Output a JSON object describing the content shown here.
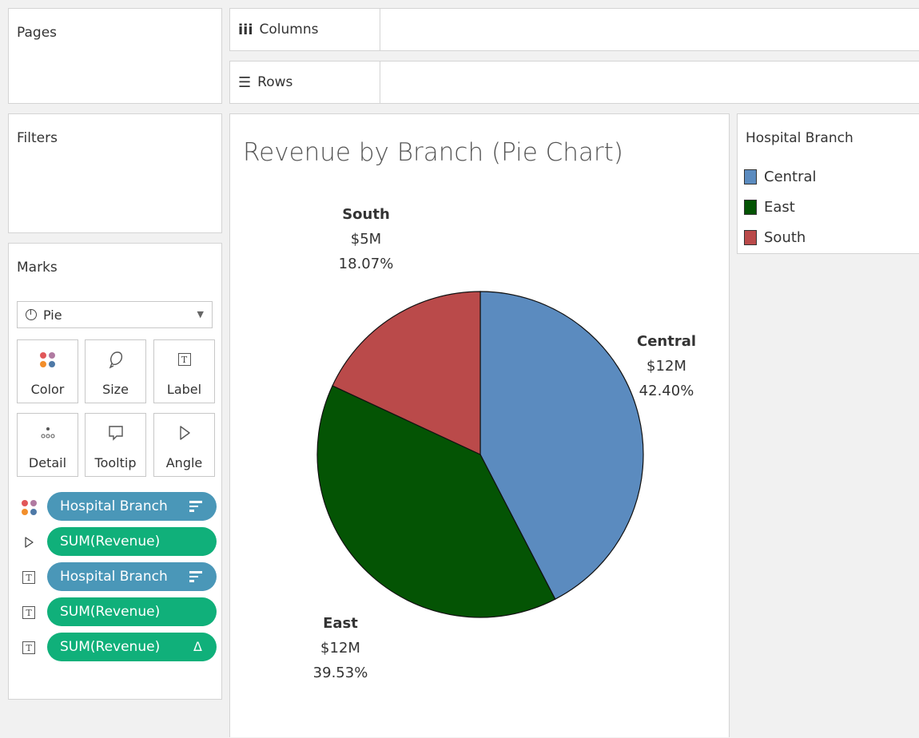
{
  "shelves": {
    "pages_label": "Pages",
    "filters_label": "Filters",
    "columns_label": "Columns",
    "rows_label": "Rows"
  },
  "marks": {
    "title": "Marks",
    "mark_type": "Pie",
    "buttons": [
      "Color",
      "Size",
      "Label",
      "Detail",
      "Tooltip",
      "Angle"
    ],
    "pills": [
      {
        "icon": "color-icon",
        "text": "Hospital Branch",
        "kind": "dimension",
        "suffix": "sort"
      },
      {
        "icon": "angle-icon",
        "text": "SUM(Revenue)",
        "kind": "measure",
        "suffix": ""
      },
      {
        "icon": "label-icon",
        "text": "Hospital Branch",
        "kind": "dimension",
        "suffix": "sort"
      },
      {
        "icon": "label-icon",
        "text": "SUM(Revenue)",
        "kind": "measure",
        "suffix": ""
      },
      {
        "icon": "label-icon",
        "text": "SUM(Revenue)",
        "kind": "measure",
        "suffix": "Δ"
      }
    ]
  },
  "legend": {
    "title": "Hospital Branch",
    "items": [
      {
        "label": "Central",
        "color": "#5b8bbf"
      },
      {
        "label": "East",
        "color": "#045404"
      },
      {
        "label": "South",
        "color": "#ba4a4a"
      }
    ]
  },
  "chart_data": {
    "type": "pie",
    "title": "Revenue by Branch (Pie Chart)",
    "slices": [
      {
        "label": "Central",
        "value_label": "$12M",
        "percent": 42.4,
        "percent_label": "42.40%",
        "color": "#5b8bbf"
      },
      {
        "label": "East",
        "value_label": "$12M",
        "percent": 39.53,
        "percent_label": "39.53%",
        "color": "#045404"
      },
      {
        "label": "South",
        "value_label": "$5M",
        "percent": 18.07,
        "percent_label": "18.07%",
        "color": "#ba4a4a"
      }
    ]
  }
}
